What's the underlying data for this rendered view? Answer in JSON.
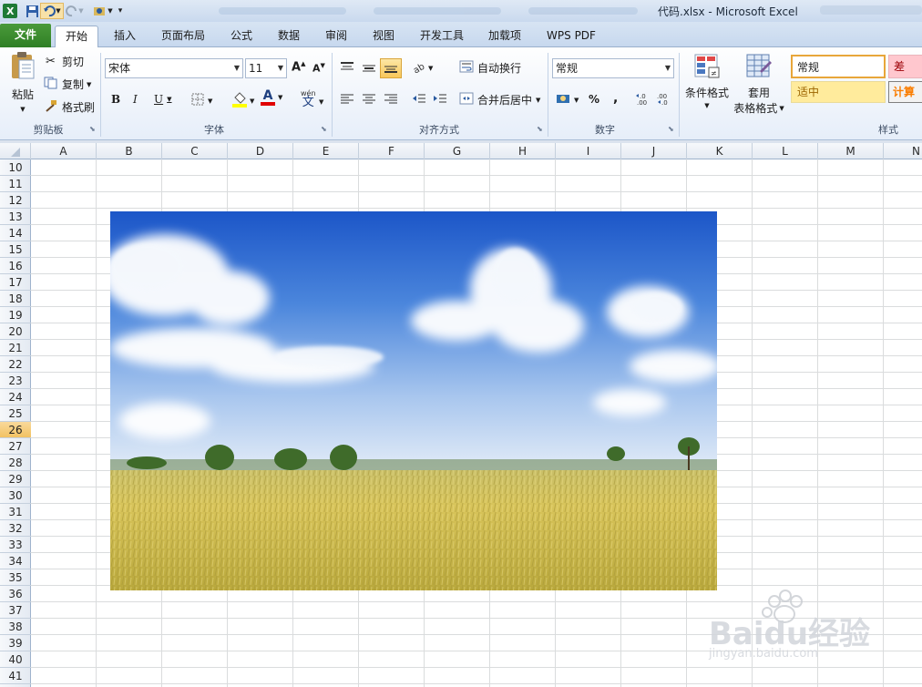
{
  "window": {
    "title": "代码.xlsx - Microsoft Excel"
  },
  "ribbon_tabs": [
    {
      "label": "文件"
    },
    {
      "label": "开始"
    },
    {
      "label": "插入"
    },
    {
      "label": "页面布局"
    },
    {
      "label": "公式"
    },
    {
      "label": "数据"
    },
    {
      "label": "审阅"
    },
    {
      "label": "视图"
    },
    {
      "label": "开发工具"
    },
    {
      "label": "加载项"
    },
    {
      "label": "WPS PDF"
    }
  ],
  "clipboard": {
    "paste": "粘贴",
    "cut": "剪切",
    "copy": "复制",
    "format_painter": "格式刷",
    "group": "剪贴板"
  },
  "font": {
    "name": "宋体",
    "size": "11",
    "group": "字体",
    "bold": "B",
    "italic": "I",
    "underline": "U",
    "font_color_glyph": "A",
    "phonetic": "wén",
    "phonetic_glyph": "文"
  },
  "alignment": {
    "wrap_text": "自动换行",
    "merge_center": "合并后居中",
    "group": "对齐方式"
  },
  "number": {
    "format": "常规",
    "percent": "%",
    "comma": ",",
    "group": "数字"
  },
  "styles": {
    "conditional_formatting": "条件格式",
    "format_as_table_1": "套用",
    "format_as_table_2": "表格格式",
    "group": "样式",
    "normal": "常规",
    "bad": "差",
    "neutral": "适中",
    "calculation": "计算"
  },
  "columns": [
    "A",
    "B",
    "C",
    "D",
    "E",
    "F",
    "G",
    "H",
    "I",
    "J",
    "K",
    "L",
    "M",
    "N"
  ],
  "rows": [
    "10",
    "11",
    "12",
    "13",
    "14",
    "15",
    "16",
    "17",
    "18",
    "19",
    "20",
    "21",
    "22",
    "23",
    "24",
    "25",
    "26",
    "27",
    "28",
    "29",
    "30",
    "31",
    "32",
    "33",
    "34",
    "35",
    "36",
    "37",
    "38",
    "39",
    "40",
    "41"
  ],
  "selected_row": "26",
  "watermark": {
    "brand": "Baidu经验",
    "url": "jingyan.baidu.com"
  }
}
